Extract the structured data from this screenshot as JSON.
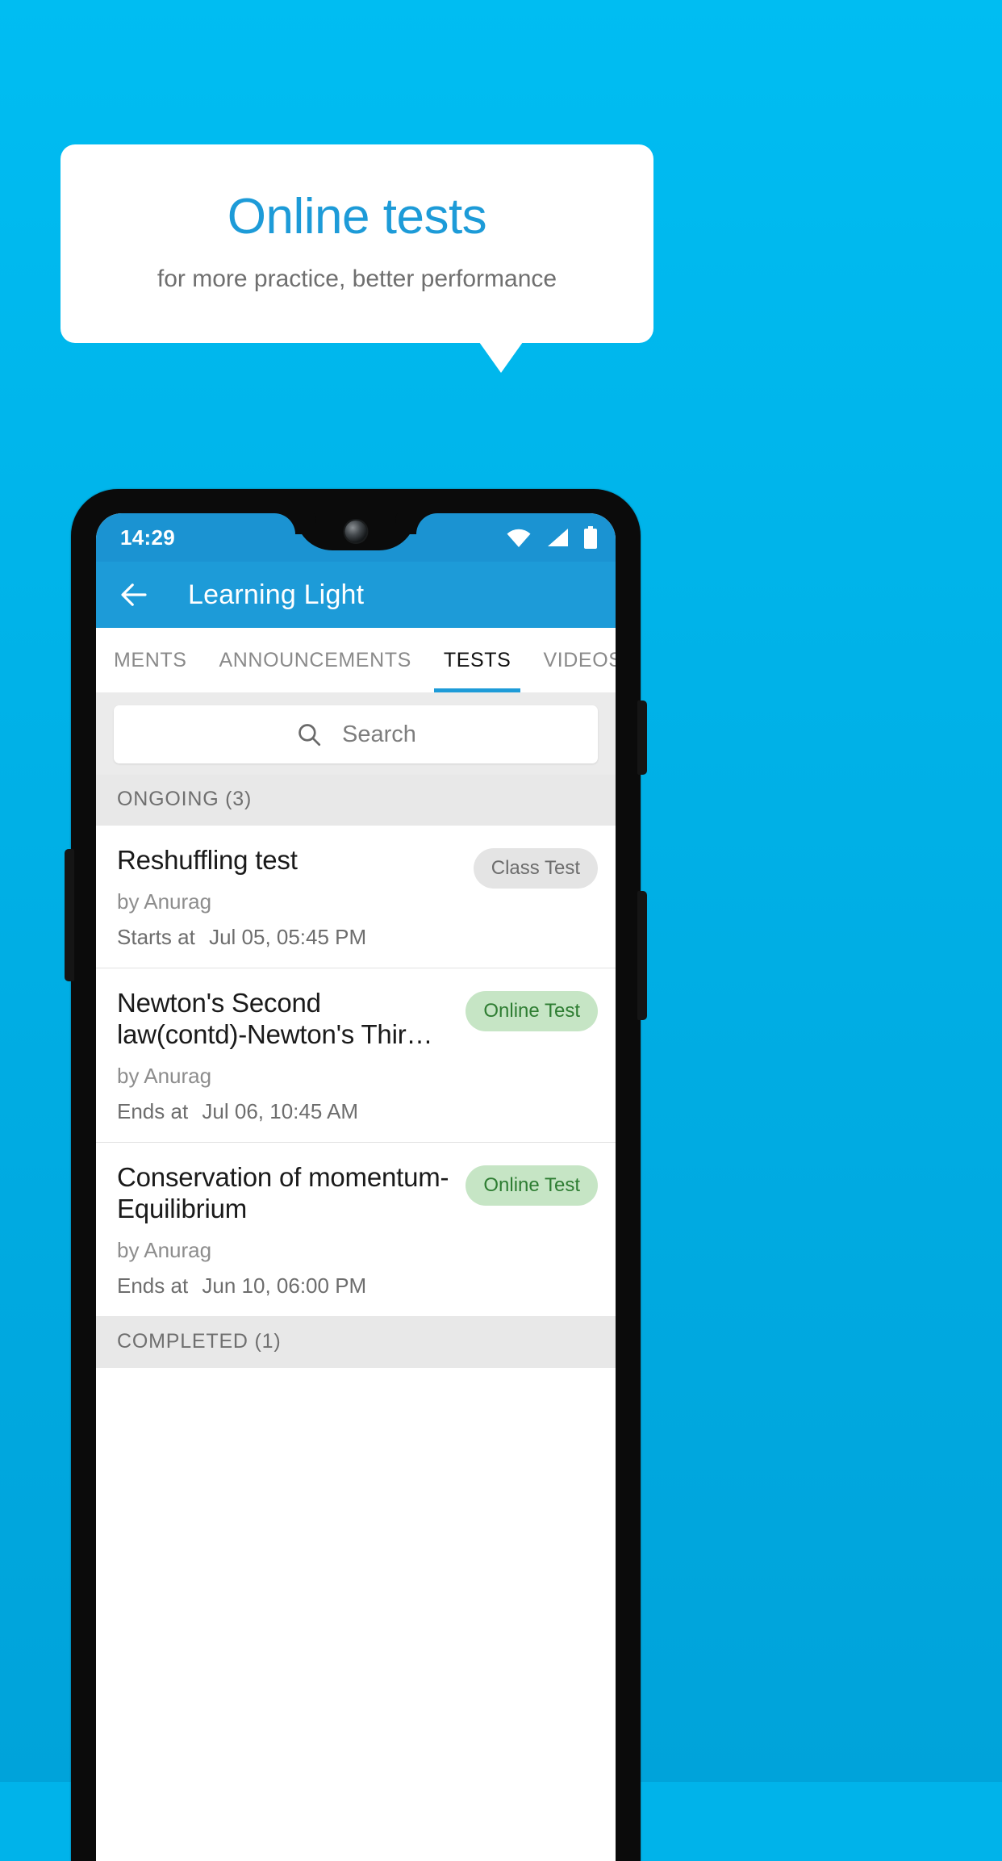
{
  "promo": {
    "title": "Online tests",
    "subtitle": "for more practice, better performance",
    "background_color": "#00b3ea",
    "title_color": "#1d9bd8",
    "bubble_color": "#ffffff"
  },
  "phone": {
    "status_bar": {
      "time": "14:29",
      "icons": [
        "wifi-icon",
        "signal-icon",
        "battery-icon"
      ],
      "background_color": "#1b93d2"
    },
    "app_bar": {
      "back_icon": "back-arrow-icon",
      "title": "Learning Light",
      "background_color": "#1d9bd8"
    },
    "tabs": [
      {
        "label": "MENTS",
        "active": false
      },
      {
        "label": "ANNOUNCEMENTS",
        "active": false
      },
      {
        "label": "TESTS",
        "active": true
      },
      {
        "label": "VIDEOS",
        "active": false
      }
    ],
    "tab_indicator_color": "#1d9bd8",
    "search": {
      "icon": "search-icon",
      "placeholder": "Search",
      "value": ""
    },
    "sections": [
      {
        "header": "ONGOING (3)",
        "items": [
          {
            "title": "Reshuffling test",
            "author": "by Anurag",
            "when_label": "Starts at",
            "when_value": "Jul 05, 05:45 PM",
            "badge": "Class Test",
            "badge_type": "gray"
          },
          {
            "title": "Newton's Second law(contd)-Newton's Thir…",
            "author": "by Anurag",
            "when_label": "Ends at",
            "when_value": "Jul 06, 10:45 AM",
            "badge": "Online Test",
            "badge_type": "green"
          },
          {
            "title": "Conservation of momentum-Equilibrium",
            "author": "by Anurag",
            "when_label": "Ends at",
            "when_value": "Jun 10, 06:00 PM",
            "badge": "Online Test",
            "badge_type": "green"
          }
        ]
      },
      {
        "header": "COMPLETED (1)",
        "items": []
      }
    ],
    "badge_colors": {
      "gray_bg": "#e4e4e4",
      "gray_text": "#6d6d6d",
      "green_bg": "#c6e5c5",
      "green_text": "#2e7d32"
    }
  }
}
